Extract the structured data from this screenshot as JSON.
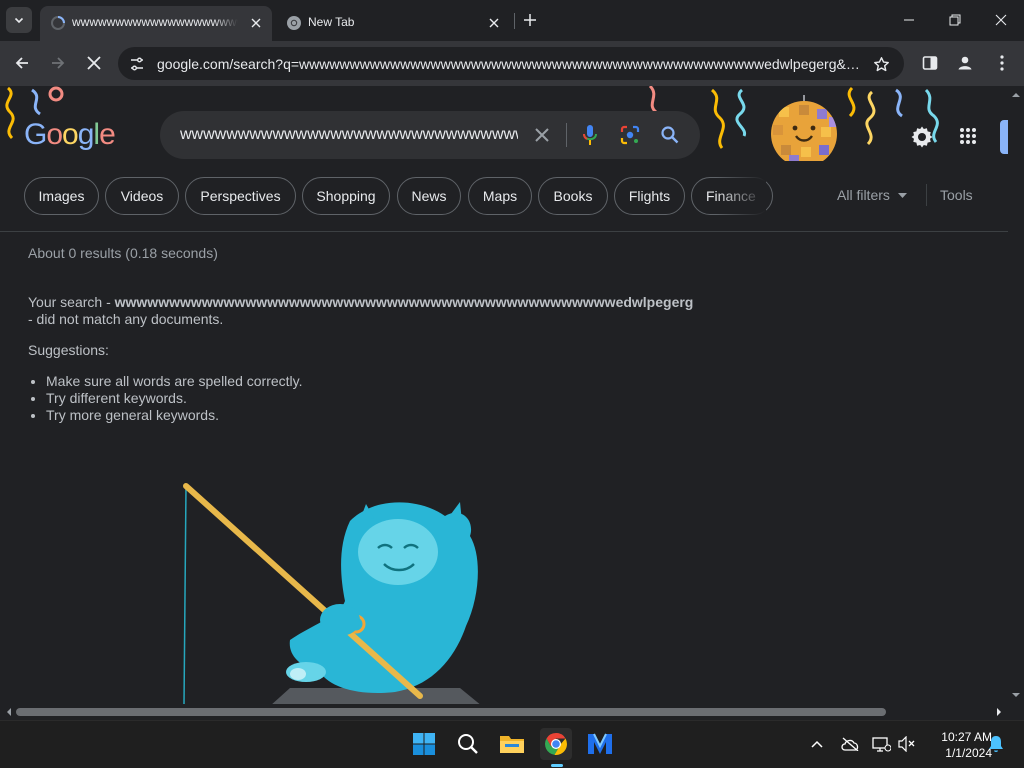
{
  "browser": {
    "tabs": [
      {
        "title": "wwwwwwwwwwwwwwwwwwwwwwwwwwwwwwwwwwwwwwwwwwwwwwedwlpegerg - Google Search",
        "state": "active",
        "icon": "loading-spinner-icon"
      },
      {
        "title": "New Tab",
        "state": "inactive",
        "icon": "chrome-icon"
      }
    ],
    "address": "google.com/search?q=wwwwwwwwwwwwwwwwwwwwwwwwwwwwwwwwwwwwwwwwwwwwwwedwlpegerg&rlz=1C1GCEA_en..."
  },
  "google": {
    "logo_letters": [
      "G",
      "o",
      "o",
      "g",
      "l",
      "e"
    ],
    "query": "wwwwwwwwwwwwwwwwwwwwwwwwwwwwwwwwwwwwwwwwwwwwwwedwlpegerg",
    "chips": [
      "Images",
      "Videos",
      "Perspectives",
      "Shopping",
      "News",
      "Maps",
      "Books",
      "Flights",
      "Finance"
    ],
    "all_filters": "All filters",
    "tools": "Tools",
    "stats": "About 0 results (0.18 seconds)",
    "noresult_prefix": "Your search - ",
    "noresult_term": "wwwwwwwwwwwwwwwwwwwwwwwwwwwwwwwwwwwwwwwwwwwwwwedwlpegerg",
    "noresult_suffix": " - did not match any documents.",
    "suggestions_title": "Suggestions:",
    "suggestions": [
      "Make sure all words are spelled correctly.",
      "Try different keywords.",
      "Try more general keywords."
    ]
  },
  "taskbar": {
    "apps": [
      "windows-start-icon",
      "search-icon",
      "file-explorer-icon",
      "chrome-icon",
      "visual-studio-icon"
    ],
    "time": "10:27 AM",
    "date": "1/1/2024"
  },
  "colors": {
    "accent_blue": "#8ab4f8",
    "google_blue": "#4285f4",
    "google_red": "#ea4335",
    "google_yellow": "#fbbc05",
    "google_green": "#34a853",
    "yeti": "#29b6d6"
  }
}
